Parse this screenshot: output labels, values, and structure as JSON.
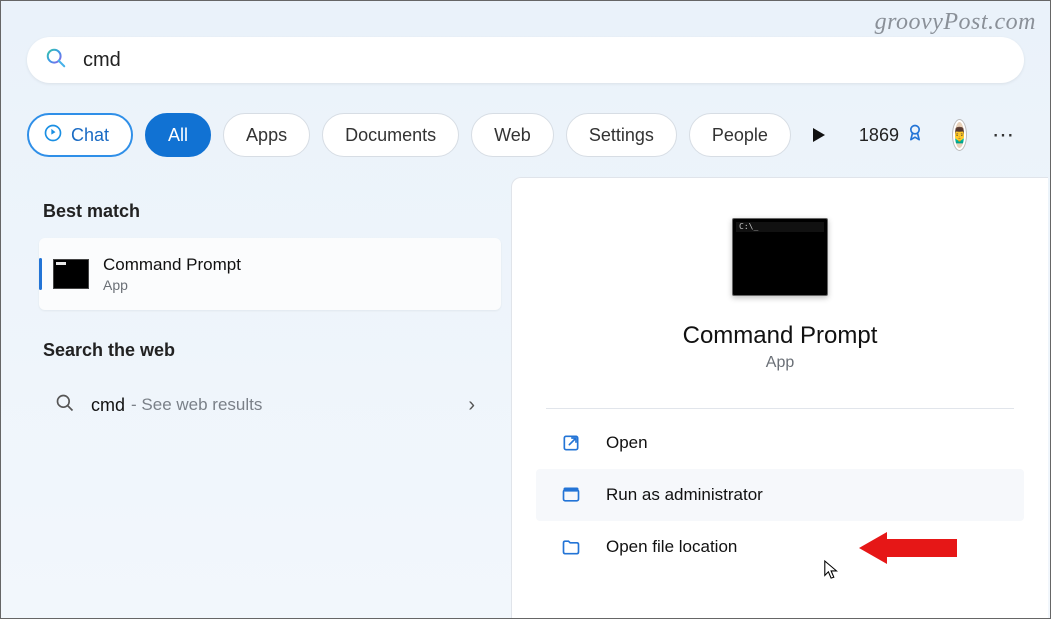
{
  "watermark": "groovyPost.com",
  "search": {
    "value": "cmd"
  },
  "filters": {
    "chat": "Chat",
    "all": "All",
    "apps": "Apps",
    "documents": "Documents",
    "web": "Web",
    "settings": "Settings",
    "people": "People"
  },
  "rewards_points": "1869",
  "left": {
    "best_match_label": "Best match",
    "result": {
      "title": "Command Prompt",
      "subtitle": "App"
    },
    "search_web_label": "Search the web",
    "web_result": {
      "query": "cmd",
      "hint": "- See web results"
    }
  },
  "panel": {
    "title": "Command Prompt",
    "subtitle": "App",
    "actions": {
      "open": "Open",
      "run_admin": "Run as administrator",
      "open_location": "Open file location"
    }
  }
}
